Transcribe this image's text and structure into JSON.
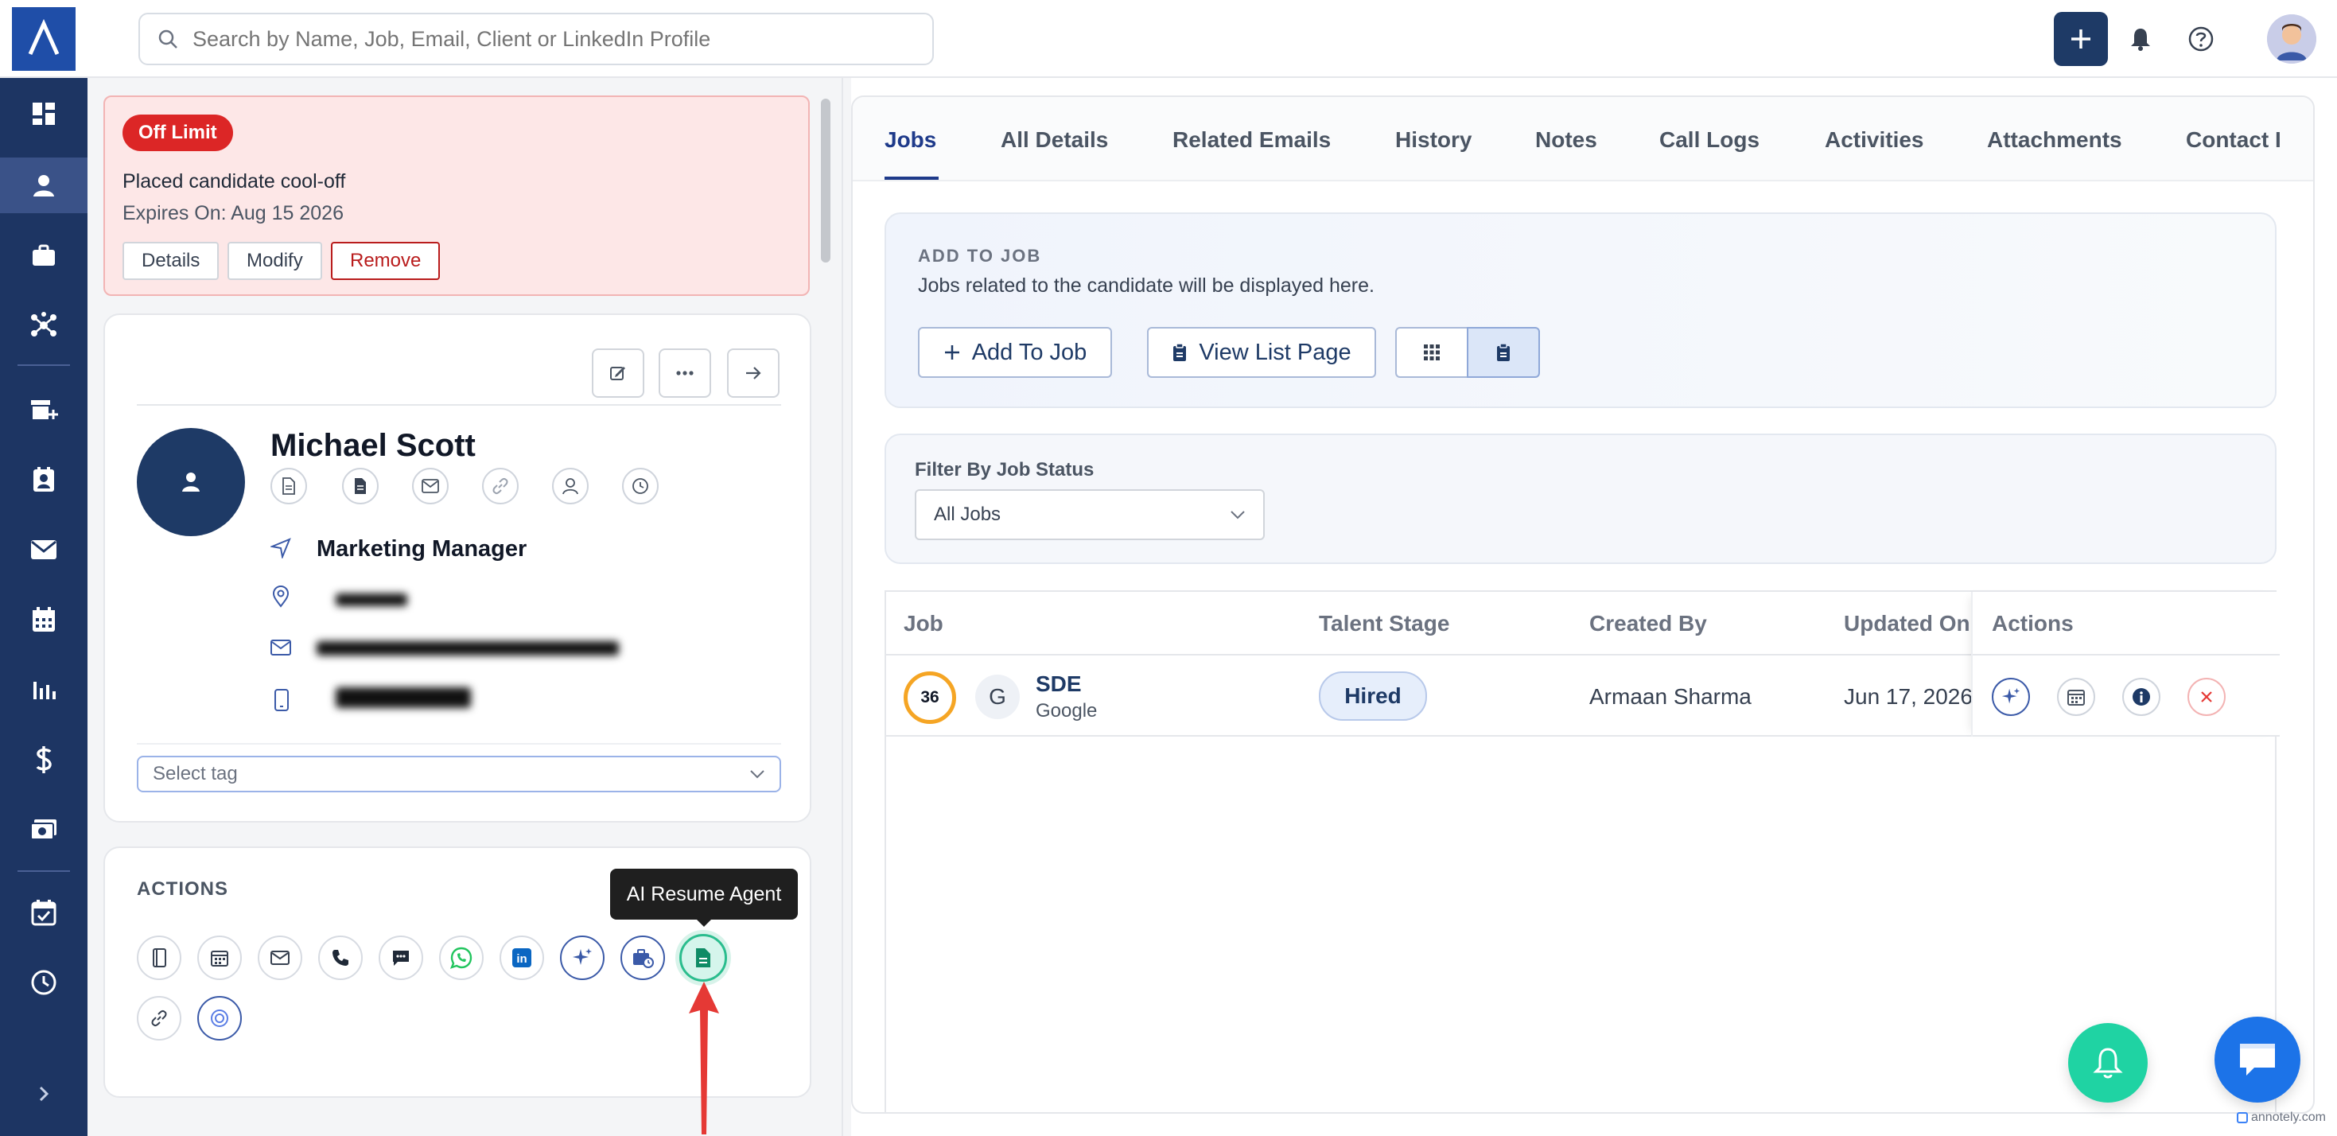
{
  "search": {
    "placeholder": "Search by Name, Job, Email, Client or LinkedIn Profile"
  },
  "off_limit": {
    "badge": "Off Limit",
    "reason": "Placed candidate cool-off",
    "expires": "Expires On: Aug 15 2026",
    "details_label": "Details",
    "modify_label": "Modify",
    "remove_label": "Remove"
  },
  "profile": {
    "name": "Michael Scott",
    "title": "Marketing Manager",
    "tag_placeholder": "Select tag"
  },
  "actions": {
    "heading": "ACTIONS",
    "tooltip": "AI Resume Agent"
  },
  "tabs": [
    "Jobs",
    "All Details",
    "Related Emails",
    "History",
    "Notes",
    "Call Logs",
    "Activities",
    "Attachments",
    "Contact I"
  ],
  "add_to_job": {
    "heading": "ADD TO JOB",
    "desc": "Jobs related to the candidate will be displayed here.",
    "add_btn": "Add To Job",
    "view_btn": "View List Page"
  },
  "filter": {
    "label": "Filter By Job Status",
    "value": "All Jobs"
  },
  "table": {
    "headers": {
      "job": "Job",
      "stage": "Talent Stage",
      "created": "Created By",
      "updated": "Updated On",
      "actions": "Actions"
    },
    "rows": [
      {
        "score": "36",
        "logo": "G",
        "job": "SDE",
        "client": "Google",
        "stage": "Hired",
        "created_by": "Armaan Sharma",
        "updated_on": "Jun 17, 2026"
      }
    ]
  },
  "watermark": "annotely.com",
  "colors": {
    "sidebar": "#1d3563",
    "accent": "#1e3a66",
    "danger": "#dc2626",
    "score_ring": "#f5a524",
    "fab_bell": "#1fd3a3",
    "fab_chat": "#1c73e8"
  }
}
